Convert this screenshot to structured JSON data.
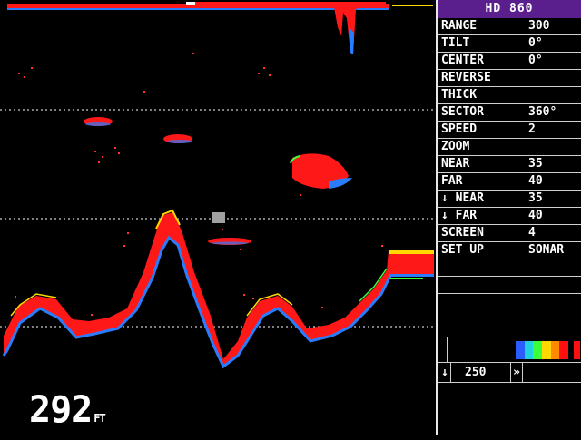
{
  "panel": {
    "title": "HD 860",
    "menu": [
      {
        "label": "RANGE",
        "value": "300"
      },
      {
        "label": "TILT",
        "value": "0°"
      },
      {
        "label": "CENTER",
        "value": "0°"
      },
      {
        "label": "REVERSE",
        "value": ""
      },
      {
        "label": "THICK",
        "value": ""
      },
      {
        "label": "SECTOR",
        "value": "360°"
      },
      {
        "label": "SPEED",
        "value": "2"
      },
      {
        "label": "ZOOM",
        "value": ""
      },
      {
        "label": "NEAR",
        "value": "35"
      },
      {
        "label": "FAR",
        "value": "40"
      },
      {
        "label": "↓ NEAR",
        "value": "35"
      },
      {
        "label": "↓ FAR",
        "value": "40"
      },
      {
        "label": "SCREEN",
        "value": "4"
      },
      {
        "label": "SET UP",
        "value": "SONAR"
      }
    ],
    "color_scale": [
      "#2a5cff",
      "#1fd0e0",
      "#3cff3c",
      "#ffd800",
      "#ff8a00",
      "#ff1010"
    ],
    "bottom": {
      "down_arrow": "↓",
      "value": "250",
      "forward_arrow": "»"
    }
  },
  "display": {
    "depth_value": "292",
    "depth_unit": "FT",
    "colors": {
      "echo": "#ff1818",
      "edge_blue": "#2a7cff",
      "edge_green": "#3cff3c",
      "edge_yellow": "#ffd800",
      "grid": "#ffffff",
      "panel_title_bg": "#5a1f8c"
    }
  }
}
